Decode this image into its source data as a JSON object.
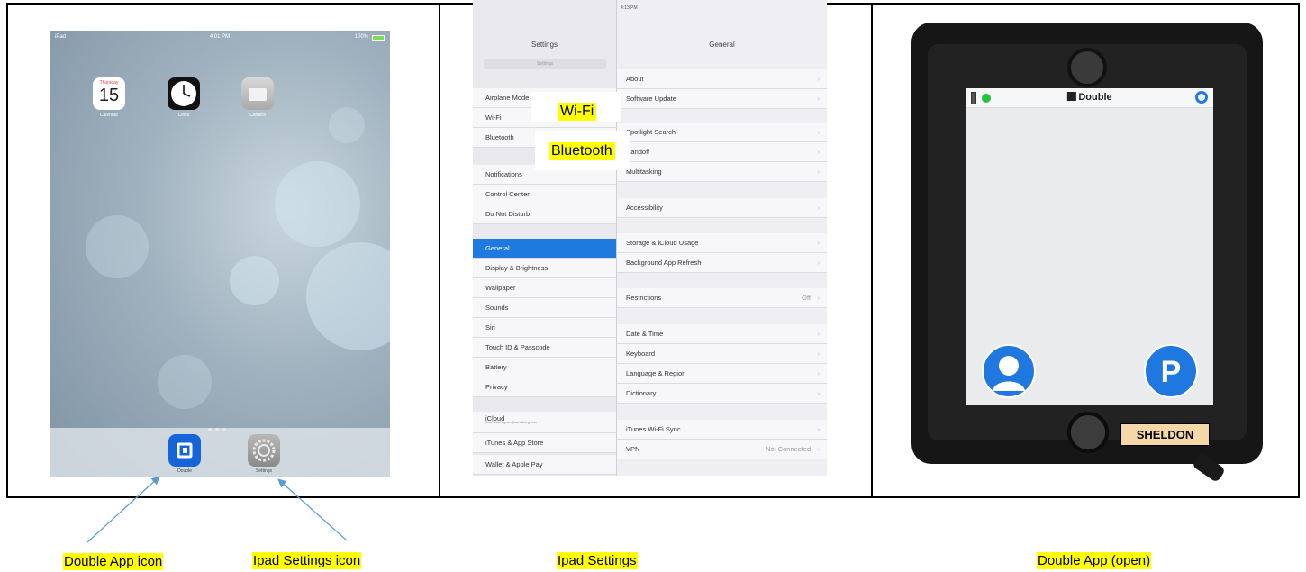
{
  "home": {
    "status_left": "iPad",
    "status_time": "4:01 PM",
    "status_battery": "100%",
    "calendar": {
      "day_name": "Thursday",
      "date": "15",
      "label": "Calendar"
    },
    "clock_label": "Clock",
    "camera_label": "Camera",
    "dock": {
      "double_label": "Double",
      "settings_label": "Settings"
    }
  },
  "settings": {
    "sidebar_title": "Settings",
    "detail_title": "General",
    "time": "4:13 PM",
    "search_placeholder": "Settings",
    "sidebar_items": [
      "Airplane Mode",
      "Wi-Fi",
      "Bluetooth",
      "Notifications",
      "Control Center",
      "Do Not Disturb",
      "General",
      "Display & Brightness",
      "Wallpaper",
      "Sounds",
      "Siri",
      "Touch ID & Passcode",
      "Battery",
      "Privacy",
      "iCloud",
      "iTunes & App Store",
      "Wallet & Apple Pay"
    ],
    "icloud_email": "instructdesigner@sandburg.edu",
    "detail_rows": [
      "About",
      "Software Update",
      "Spotlight Search",
      "Handoff",
      "Multitasking",
      "Accessibility",
      "Storage & iCloud Usage",
      "Background App Refresh",
      "Restrictions",
      "Date & Time",
      "Keyboard",
      "Language & Region",
      "Dictionary",
      "iTunes Wi-Fi Sync",
      "VPN"
    ],
    "restrictions_value": "Off",
    "vpn_value": "Not Connected",
    "overlay_wifi": "Wi-Fi",
    "overlay_bluetooth": "Bluetooth"
  },
  "double_app": {
    "brand": "Double",
    "name_tag": "SHELDON",
    "driver_button": "P"
  },
  "captions": {
    "double_icon": "Double App icon",
    "settings_icon": "Ipad Settings icon",
    "ipad_settings": "Ipad Settings",
    "double_open": "Double App (open)"
  },
  "colors": {
    "highlight": "#ffff00",
    "ios_blue": "#1f7ae0",
    "status_green": "#22c33b"
  }
}
